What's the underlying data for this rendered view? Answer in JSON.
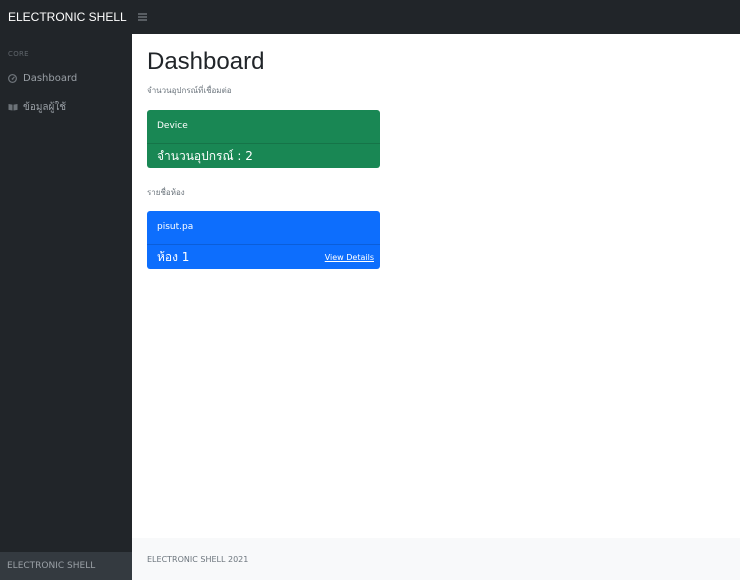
{
  "topnav": {
    "brand": "ELECTRONIC SHELL",
    "toggle_icon": "hamburger-menu-icon"
  },
  "sidebar": {
    "heading": "CORE",
    "items": [
      {
        "label": "Dashboard",
        "icon": "tachometer-icon"
      },
      {
        "label": "ข้อมูลผู้ใช้",
        "icon": "book-open-icon"
      }
    ],
    "footer": "ELECTRONIC SHELL"
  },
  "main": {
    "title": "Dashboard",
    "subtitle": "จำนวนอุปกรณ์ที่เชื่อมต่อ",
    "device_card": {
      "header": "Device",
      "footer_text": "จำนวนอุปกรณ์ : 2",
      "color": "#198754"
    },
    "section_label": "รายชื่อห้อง",
    "room_card": {
      "header": "pisut.pa",
      "footer_text": "ห้อง 1",
      "link_label": "View Details",
      "color": "#0d6efd"
    }
  },
  "footer": {
    "text": "ELECTRONIC SHELL 2021"
  }
}
